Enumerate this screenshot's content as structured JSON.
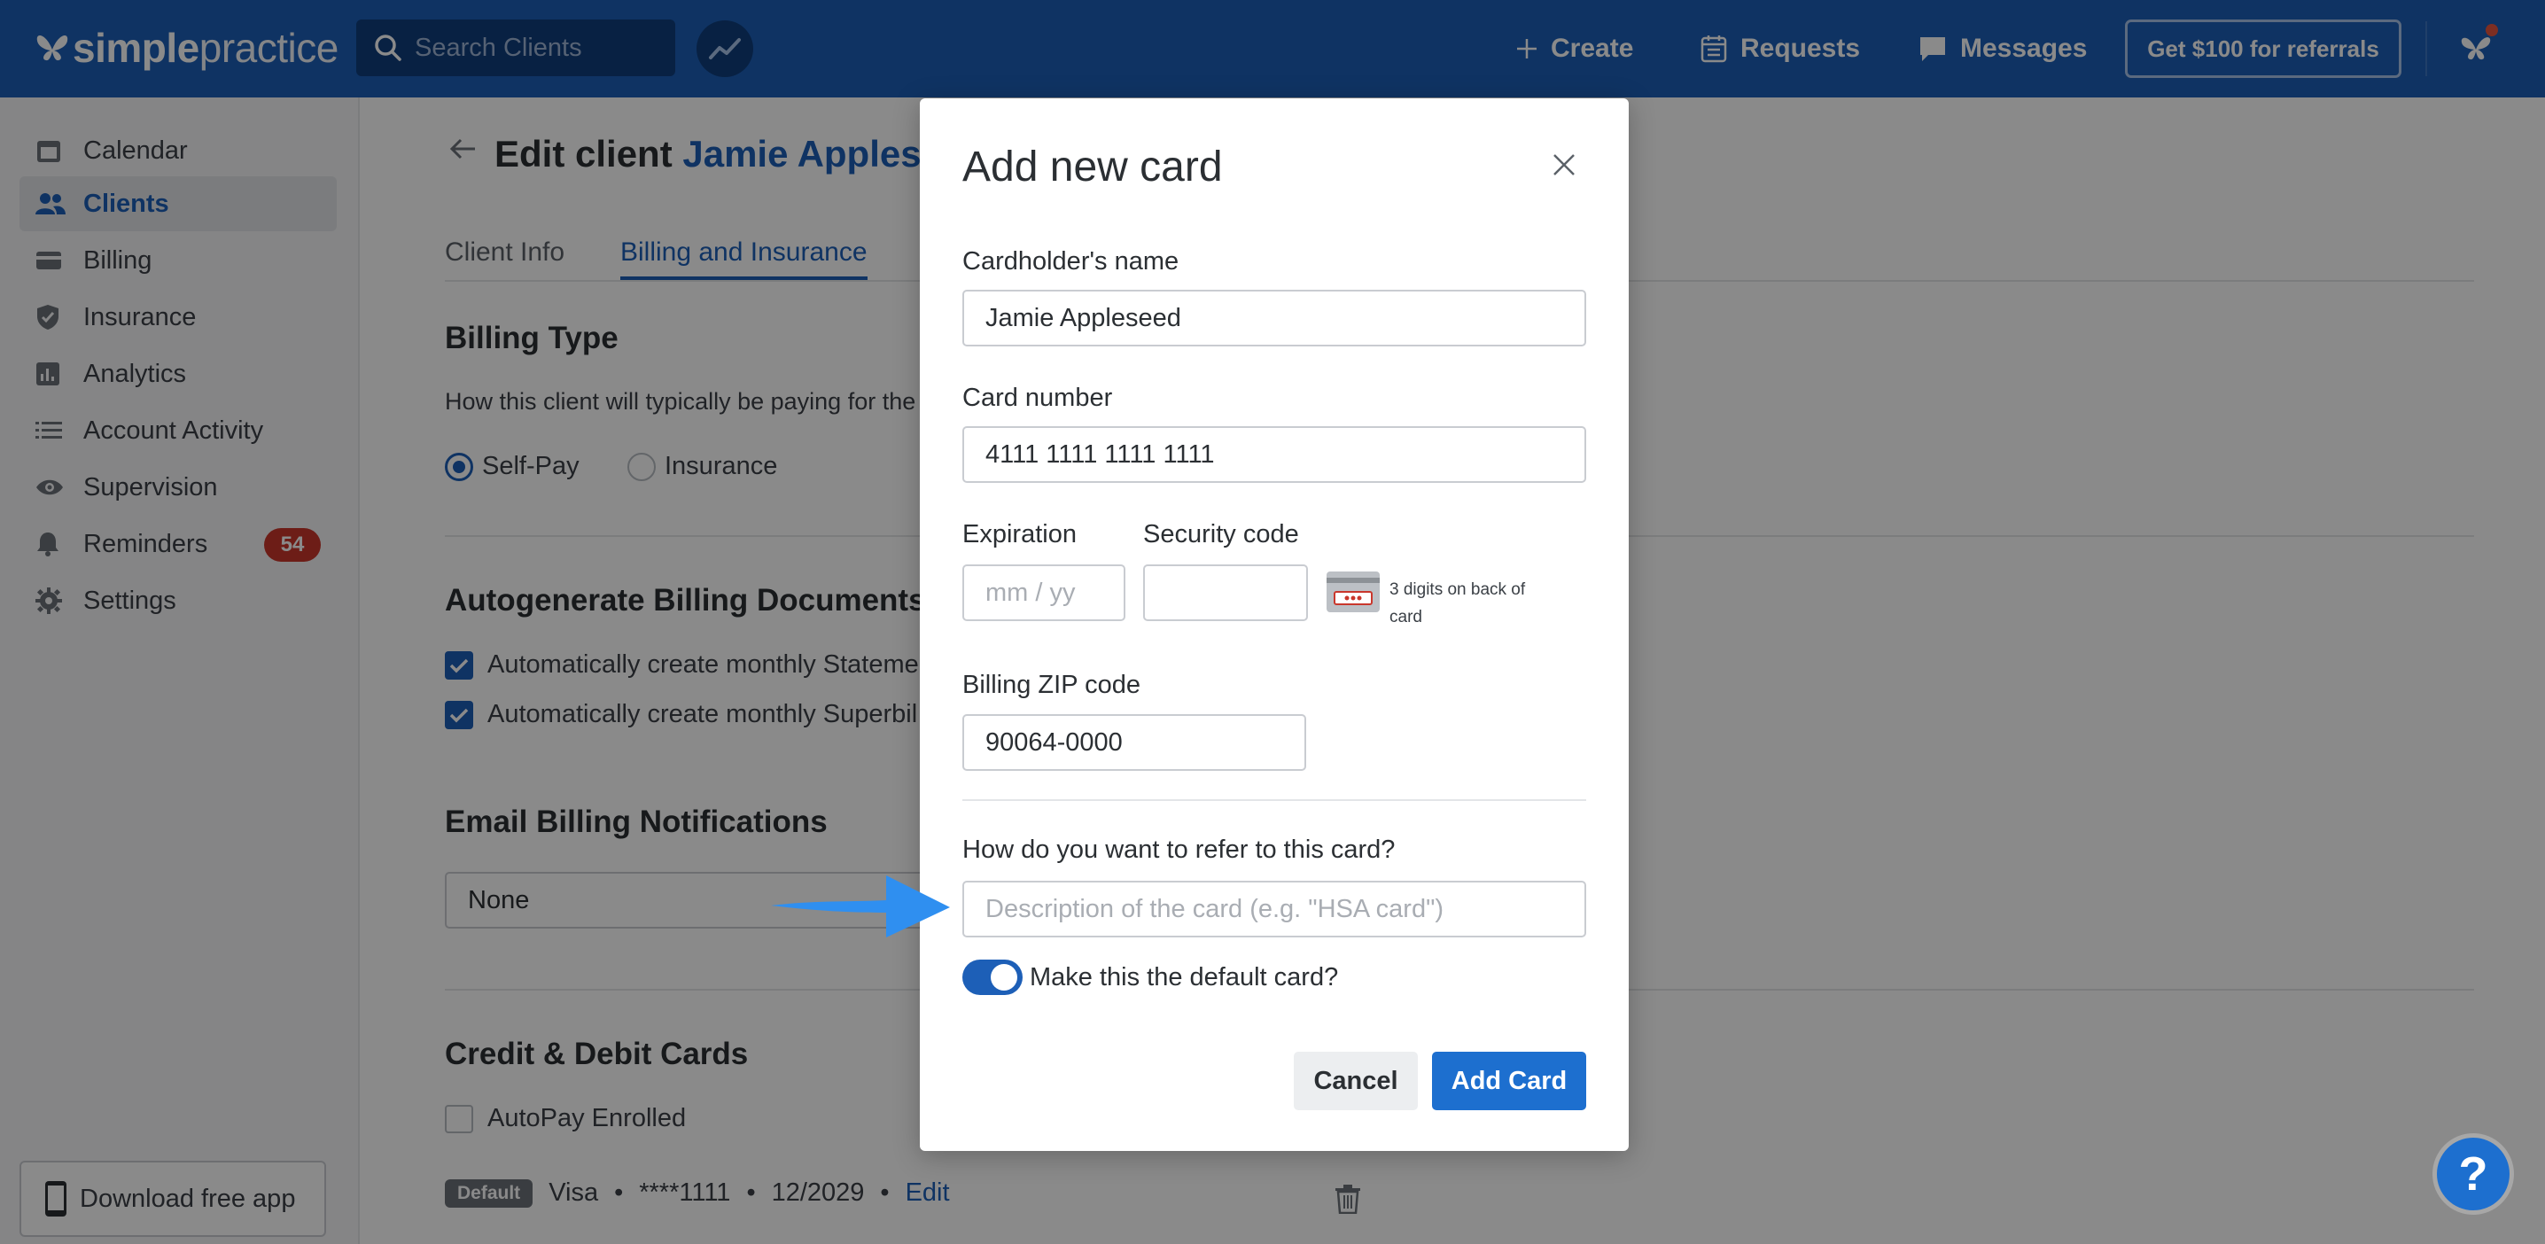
{
  "app": {
    "logo_bold": "simple",
    "logo_thin": "practice"
  },
  "topbar": {
    "search_placeholder": "Search Clients",
    "create_label": "Create",
    "requests_label": "Requests",
    "messages_label": "Messages",
    "referral_label": "Get $100 for referrals"
  },
  "sidebar": {
    "items": [
      {
        "label": "Calendar",
        "icon": "calendar-icon"
      },
      {
        "label": "Clients",
        "icon": "clients-icon",
        "active": true
      },
      {
        "label": "Billing",
        "icon": "billing-icon"
      },
      {
        "label": "Insurance",
        "icon": "insurance-icon"
      },
      {
        "label": "Analytics",
        "icon": "analytics-icon"
      },
      {
        "label": "Account Activity",
        "icon": "activity-icon"
      },
      {
        "label": "Supervision",
        "icon": "eye-icon"
      },
      {
        "label": "Reminders",
        "icon": "bell-icon",
        "badge": "54"
      },
      {
        "label": "Settings",
        "icon": "gear-icon"
      }
    ],
    "download_label": "Download free app"
  },
  "page": {
    "title_prefix": "Edit client",
    "client_name": "Jamie Appleseed",
    "tabs": [
      "Client Info",
      "Billing and Insurance"
    ],
    "billing_type_heading": "Billing Type",
    "billing_type_desc": "How this client will typically be paying for the",
    "self_pay_label": "Self-Pay",
    "insurance_label": "Insurance",
    "autogen_heading": "Autogenerate Billing Documents",
    "autogen_statements": "Automatically create monthly Stateme",
    "autogen_superbills": "Automatically create monthly Superbil",
    "email_heading": "Email Billing Notifications",
    "email_value": "None",
    "cards_heading": "Credit & Debit Cards",
    "autopay_label": "AutoPay Enrolled",
    "card": {
      "tag": "Default",
      "brand": "Visa",
      "number": "****1111",
      "expiry": "12/2029",
      "edit_label": "Edit",
      "dot": "•"
    }
  },
  "modal": {
    "title": "Add new card",
    "cardholder_label": "Cardholder's name",
    "cardholder_value": "Jamie Appleseed",
    "card_number_label": "Card number",
    "card_number_value": "4111 1111 1111 1111",
    "expiration_label": "Expiration",
    "expiration_placeholder": "mm / yy",
    "security_label": "Security code",
    "security_hint": "3 digits on back of card",
    "zip_label": "Billing ZIP code",
    "zip_value": "90064-0000",
    "refer_label": "How do you want to refer to this card?",
    "refer_placeholder": "Description of the card (e.g. \"HSA card\")",
    "default_toggle_label": "Make this the default card?",
    "default_toggle_on": true,
    "cancel_label": "Cancel",
    "add_label": "Add Card"
  },
  "help_label": "?",
  "colors": {
    "brand": "#1d5fb7",
    "primary_button": "#1d6fcf",
    "badge": "#c9372c",
    "arrow": "#2f8ff0"
  }
}
